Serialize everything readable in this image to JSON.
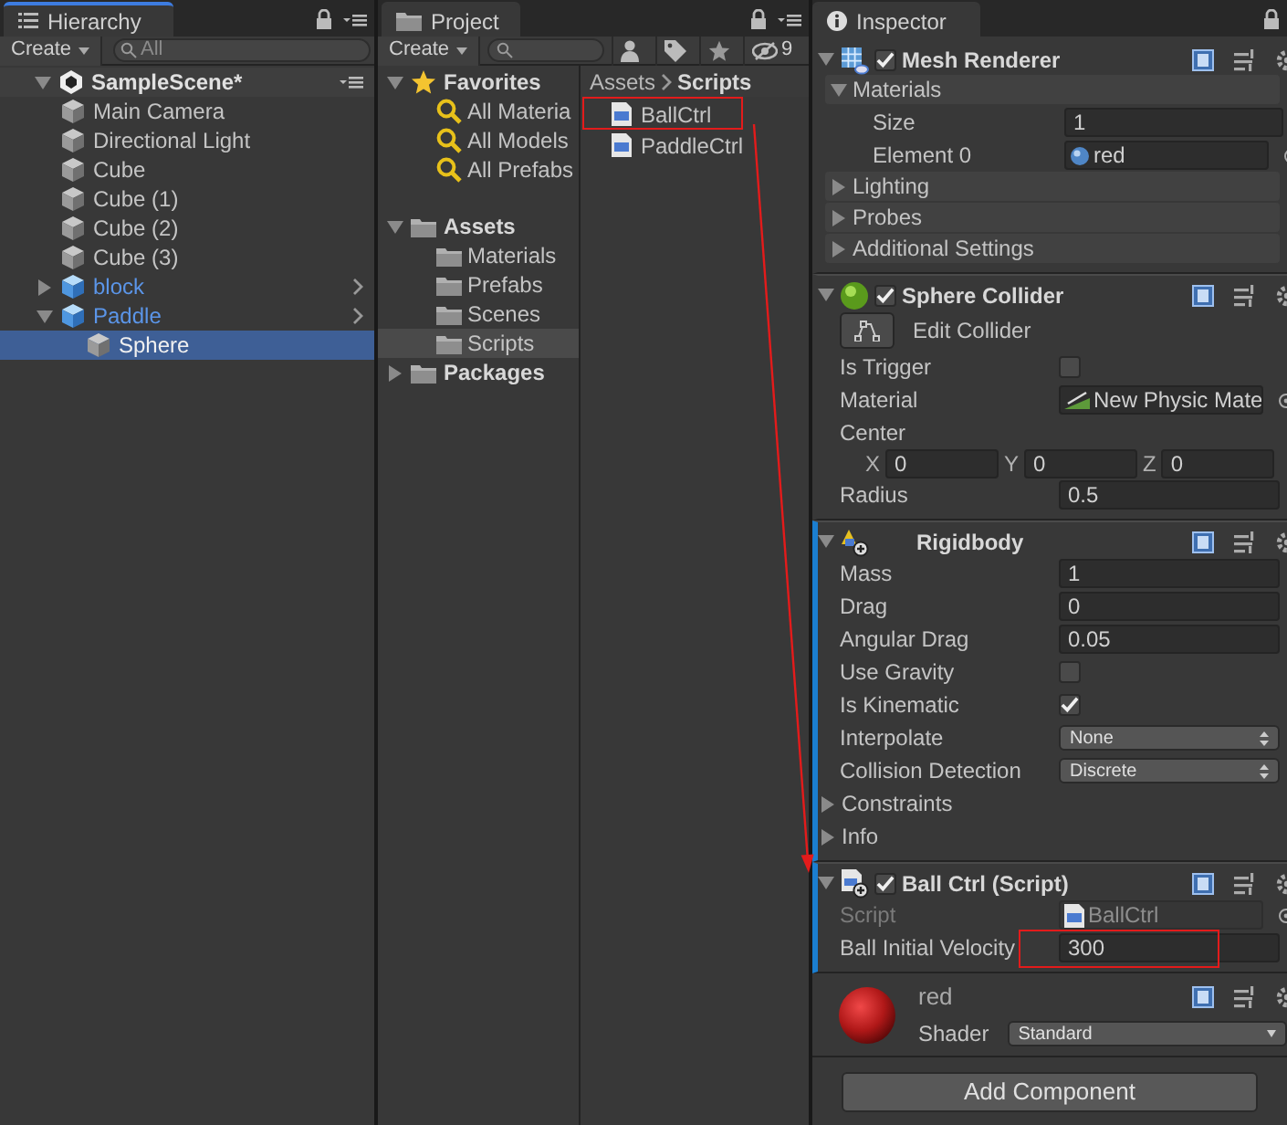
{
  "hierarchy": {
    "tab": {
      "label": "Hierarchy",
      "focused": true
    },
    "create": "Create",
    "search_placeholder": "All",
    "scene": {
      "name": "SampleScene*",
      "expanded": true,
      "children": [
        {
          "name": "Main Camera",
          "kind": "object",
          "selected": false
        },
        {
          "name": "Directional Light",
          "kind": "object",
          "selected": false
        },
        {
          "name": "Cube",
          "kind": "object",
          "selected": false
        },
        {
          "name": "Cube (1)",
          "kind": "object",
          "selected": false
        },
        {
          "name": "Cube (2)",
          "kind": "object",
          "selected": false
        },
        {
          "name": "Cube (3)",
          "kind": "object",
          "selected": false
        },
        {
          "name": "block",
          "kind": "prefab",
          "expanded": false,
          "selected": false
        },
        {
          "name": "Paddle",
          "kind": "prefab",
          "expanded": true,
          "selected": false,
          "children": [
            {
              "name": "Sphere",
              "kind": "object",
              "selected": true
            }
          ]
        }
      ]
    }
  },
  "project": {
    "tab": {
      "label": "Project",
      "focused": false
    },
    "create": "Create",
    "hidden_count": "9",
    "tree": [
      {
        "label": "Favorites",
        "kind": "favorites",
        "expanded": true,
        "children": [
          {
            "label": "All Materia",
            "kind": "search",
            "selected": false
          },
          {
            "label": "All Models",
            "kind": "search",
            "selected": false
          },
          {
            "label": "All Prefabs",
            "kind": "search",
            "selected": false
          }
        ]
      },
      {
        "label": "Assets",
        "kind": "folder",
        "expanded": true,
        "children": [
          {
            "label": "Materials",
            "kind": "folder",
            "selected": false
          },
          {
            "label": "Prefabs",
            "kind": "folder",
            "selected": false
          },
          {
            "label": "Scenes",
            "kind": "folder",
            "selected": false
          },
          {
            "label": "Scripts",
            "kind": "folder",
            "selected": true
          }
        ]
      },
      {
        "label": "Packages",
        "kind": "folder",
        "expanded": false
      }
    ],
    "breadcrumb": [
      "Assets",
      "Scripts"
    ],
    "files": [
      {
        "name": "BallCtrl",
        "highlighted": true
      },
      {
        "name": "PaddleCtrl",
        "highlighted": false
      }
    ]
  },
  "inspector": {
    "tab": {
      "label": "Inspector",
      "focused": false
    },
    "components": [
      {
        "title": "Mesh Renderer",
        "kind": "mesh_renderer",
        "enabled": true,
        "expanded": true,
        "overridden": false,
        "properties": [
          {
            "kind": "section",
            "label": "Materials",
            "expanded": true,
            "children": [
              {
                "kind": "field",
                "label": "Size",
                "value": "1"
              },
              {
                "kind": "object",
                "label": "Element 0",
                "value": "red",
                "disabled": false
              }
            ]
          },
          {
            "kind": "section",
            "label": "Lighting",
            "expanded": false
          },
          {
            "kind": "section",
            "label": "Probes",
            "expanded": false
          },
          {
            "kind": "section",
            "label": "Additional Settings",
            "expanded": false
          }
        ]
      },
      {
        "title": "Sphere Collider",
        "kind": "sphere_collider",
        "enabled": true,
        "expanded": true,
        "overridden": false,
        "properties": [
          {
            "kind": "button",
            "label": "Edit Collider"
          },
          {
            "kind": "checkbox",
            "label": "Is Trigger",
            "checked": false
          },
          {
            "kind": "object",
            "label": "Material",
            "value": "New Physic Mate",
            "disabled": false
          },
          {
            "kind": "label",
            "label": "Center"
          },
          {
            "kind": "vector",
            "fields": [
              {
                "axis": "X",
                "value": "0"
              },
              {
                "axis": "Y",
                "value": "0"
              },
              {
                "axis": "Z",
                "value": "0"
              }
            ]
          },
          {
            "kind": "field",
            "label": "Radius",
            "value": "0.5"
          }
        ]
      },
      {
        "title": "Rigidbody",
        "kind": "rigidbody",
        "expanded": true,
        "overridden": true,
        "properties": [
          {
            "kind": "field",
            "label": "Mass",
            "value": "1"
          },
          {
            "kind": "field",
            "label": "Drag",
            "value": "0"
          },
          {
            "kind": "field",
            "label": "Angular Drag",
            "value": "0.05"
          },
          {
            "kind": "checkbox",
            "label": "Use Gravity",
            "checked": false
          },
          {
            "kind": "checkbox",
            "label": "Is Kinematic",
            "checked": true
          },
          {
            "kind": "dropdown",
            "label": "Interpolate",
            "value": "None"
          },
          {
            "kind": "dropdown",
            "label": "Collision Detection",
            "value": "Discrete"
          },
          {
            "kind": "foldout",
            "label": "Constraints",
            "expanded": false
          },
          {
            "kind": "foldout",
            "label": "Info",
            "expanded": false
          }
        ]
      },
      {
        "title": "Ball Ctrl (Script)",
        "kind": "script",
        "enabled": true,
        "expanded": true,
        "overridden": true,
        "properties": [
          {
            "kind": "object",
            "label": "Script",
            "value": "BallCtrl",
            "disabled": true
          },
          {
            "kind": "field",
            "label": "Ball Initial Velocity",
            "value": "300",
            "highlighted": true
          }
        ]
      }
    ],
    "material": {
      "name": "red",
      "shader_label": "Shader",
      "shader": "Standard"
    },
    "add_component": "Add Component"
  }
}
